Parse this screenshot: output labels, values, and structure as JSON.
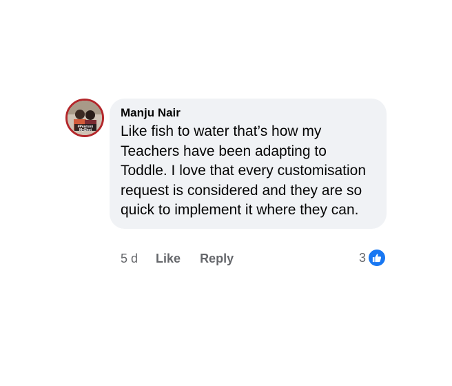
{
  "comment": {
    "author": "Manju Nair",
    "text": "Like fish to water that’s how my Teachers have been adapting to Toddle. I love that every customisation request is considered and they are so quick to implement it where they can.",
    "timestamp": "5 d",
    "like_label": "Like",
    "reply_label": "Reply",
    "reaction_count": "3",
    "reaction_icon": "thumbs-up-icon",
    "avatar_frame_color": "#b3262a",
    "avatar_text": "#Pearson MyShot"
  },
  "colors": {
    "bubble_bg": "#f0f2f5",
    "text": "#050505",
    "secondary": "#65676b",
    "like_blue": "#1877f2"
  }
}
